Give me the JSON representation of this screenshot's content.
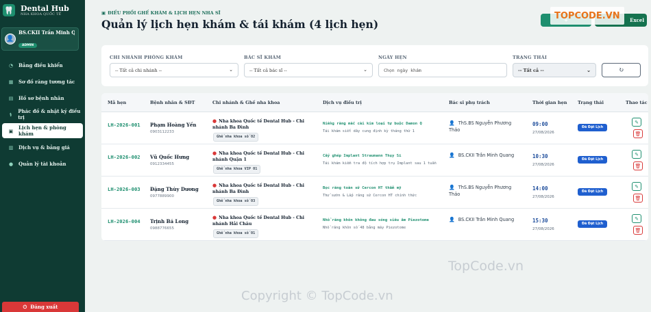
{
  "brand": {
    "name": "Dental Hub",
    "subtitle": "NHA KHOA QUỐC TẾ"
  },
  "user": {
    "name": "BS.CKII Trần Minh Qu...",
    "role": "ADMIN"
  },
  "nav": [
    {
      "label": "Bảng điều khiển",
      "icon": "gauge-icon"
    },
    {
      "label": "Sơ đồ răng tương tác",
      "icon": "grid-icon"
    },
    {
      "label": "Hồ sơ bệnh nhân",
      "icon": "clipboard-icon"
    },
    {
      "label": "Phác đồ & nhật ký điều trị",
      "icon": "stethoscope-icon"
    },
    {
      "label": "Lịch hẹn & phòng khám",
      "icon": "calendar-icon",
      "active": true
    },
    {
      "label": "Dịch vụ & bảng giá",
      "icon": "price-tag-icon"
    },
    {
      "label": "Quản lý tài khoản",
      "icon": "user-icon"
    }
  ],
  "logout": "Đăng xuất",
  "header": {
    "eyebrow": "ĐIỀU PHỐI GHẾ KHÁM & LỊCH HẸN NHA SĨ",
    "title": "Quản lý lịch hẹn khám & tái khám (4 lịch hẹn)",
    "add_button": "+",
    "excel_button": "Excel"
  },
  "watermark": {
    "top": "TOPCODE.VN",
    "middle": "TopCode.vn",
    "bottom": "Copyright © TopCode.vn"
  },
  "filters": {
    "branch": {
      "label": "CHI NHÁNH PHÒNG KHÁM",
      "value": "-- Tất cả chi nhánh --"
    },
    "doctor": {
      "label": "BÁC SĨ KHÁM",
      "value": "-- Tất cả bác sĩ --"
    },
    "date": {
      "label": "NGÀY HẸN",
      "placeholder": "Chọn ngày khám"
    },
    "status": {
      "label": "TRẠNG THÁI",
      "value": "-- Tất cả --"
    }
  },
  "table": {
    "columns": [
      "Mã hẹn",
      "Bệnh nhân & SĐT",
      "Chi nhánh & Ghế nha khoa",
      "Dịch vụ điều trị",
      "Bác sĩ phụ trách",
      "Thời gian hẹn",
      "Trạng thái",
      "Thao tác"
    ],
    "rows": [
      {
        "code": "LH-2026-001",
        "patient": "Phạm Hoàng Yến",
        "phone": "0903112233",
        "branch": "Nha khoa Quốc tế Dental Hub - Chi nhánh Ba Đình",
        "chair": "Ghế nha khoa số 02",
        "service": "Niềng răng mắc cài kim loại tự buộc Damon Q",
        "note": "Tái khám siết dây cung định kỳ tháng thứ 1",
        "doctor": "ThS.BS Nguyễn Phương Thảo",
        "time": "09:00",
        "date": "27/08/2026",
        "status": "Đã Đặt Lịch"
      },
      {
        "code": "LH-2026-002",
        "patient": "Vũ Quốc Hưng",
        "phone": "0912334455",
        "branch": "Nha khoa Quốc tế Dental Hub - Chi nhánh Quận 1",
        "chair": "Ghế nha khoa VIP 01",
        "service": "Cấy ghép Implant Straumann Thụy Sĩ",
        "note": "Tái khám kiểm tra độ tích hợp trụ Implant sau 1 tuần",
        "doctor": "BS.CKII Trần Minh Quang",
        "time": "10:30",
        "date": "27/08/2026",
        "status": "Đã Đặt Lịch"
      },
      {
        "code": "LH-2026-003",
        "patient": "Đặng Thùy Dương",
        "phone": "0977889900",
        "branch": "Nha khoa Quốc tế Dental Hub - Chi nhánh Ba Đình",
        "chair": "Ghế nha khoa số 03",
        "service": "Bọc răng toàn sứ Cercon HT thẩm mỹ",
        "note": "Thử sườn & Lắp răng sứ Cercon HT chính thức",
        "doctor": "ThS.BS Nguyễn Phương Thảo",
        "time": "14:00",
        "date": "27/08/2026",
        "status": "Đã Đặt Lịch"
      },
      {
        "code": "LH-2026-004",
        "patient": "Trịnh Bá Long",
        "phone": "0988776655",
        "branch": "Nha khoa Quốc tế Dental Hub - Chi nhánh Hải Châu",
        "chair": "Ghế nha khoa số 01",
        "service": "Nhổ răng khôn không đau sóng siêu âm Piezotome",
        "note": "Nhổ răng khôn số 48 bằng máy Piezotome",
        "doctor": "BS.CKII Trần Minh Quang",
        "time": "15:30",
        "date": "27/08/2026",
        "status": "Đã Đặt Lịch"
      }
    ]
  }
}
